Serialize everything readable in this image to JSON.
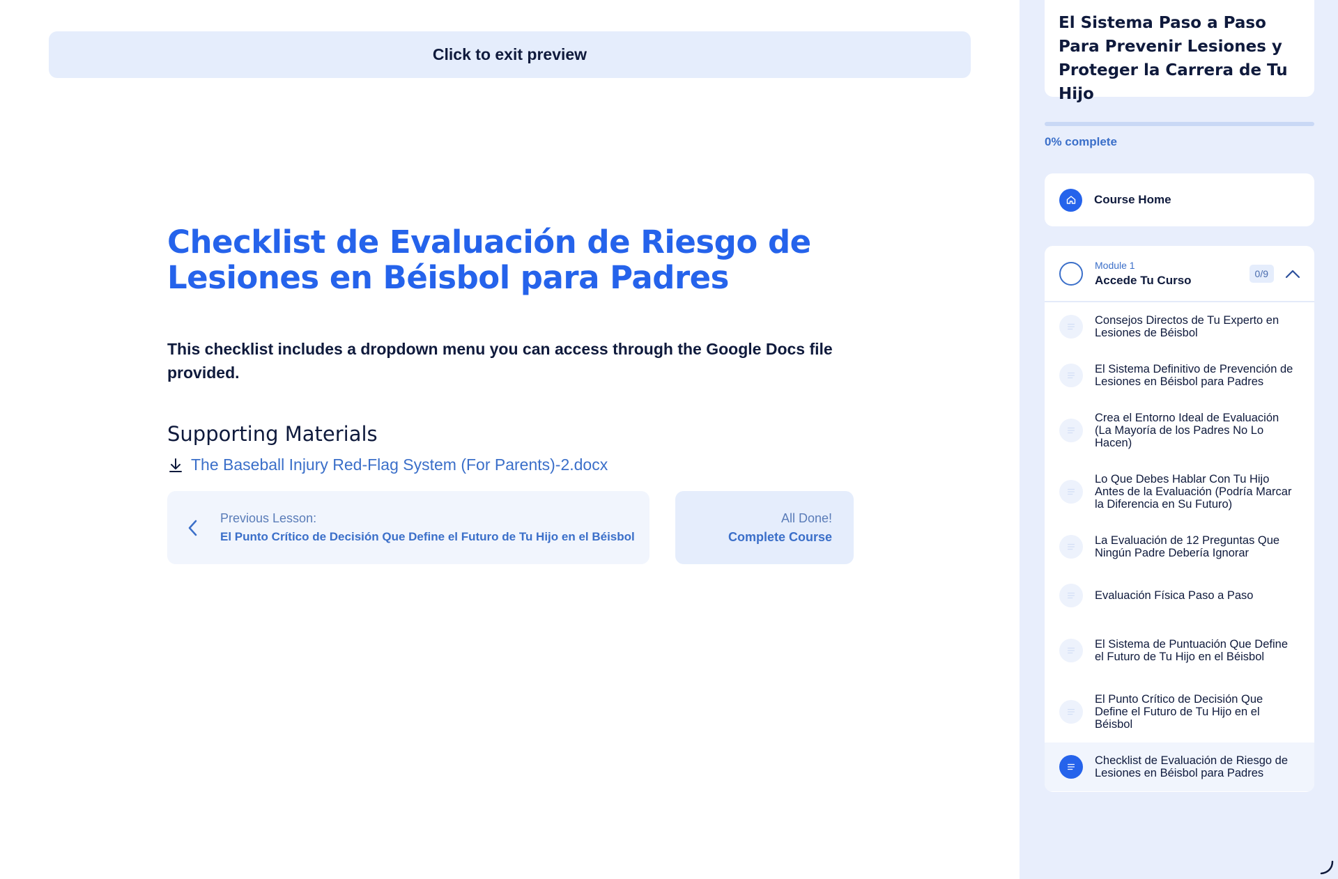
{
  "preview": {
    "exit_label": "Click to exit preview"
  },
  "lesson": {
    "title": "Checklist de Evaluación de Riesgo de Lesiones en Béisbol para Padres",
    "description": "This checklist includes a dropdown menu you can access through the Google Docs file provided.",
    "materials_heading": "Supporting Materials",
    "material_file": "The Baseball Injury Red-Flag System (For Parents)-2.docx",
    "material_icon": "download-icon"
  },
  "navigation": {
    "previous_label": "Previous Lesson:",
    "previous_name": "El Punto Crítico de Decisión Que Define el Futuro de Tu Hijo en el Béisbol",
    "done_label": "All Done!",
    "done_action": "Complete Course"
  },
  "sidebar": {
    "course_title": "El Sistema Paso a Paso Para Prevenir Lesiones y Proteger la Carrera de Tu Hijo",
    "progress_percent": 0,
    "progress_text": "0% complete",
    "home_label": "Course Home",
    "module": {
      "sub_label": "Module 1",
      "name": "Accede Tu Curso",
      "count": "0/9",
      "lessons": [
        {
          "title": "Consejos Directos de Tu Experto en Lesiones de Béisbol",
          "active": false
        },
        {
          "title": "El Sistema Definitivo de Prevención de Lesiones en Béisbol para Padres",
          "active": false
        },
        {
          "title": "Crea el Entorno Ideal de Evaluación (La Mayoría de los Padres No Lo Hacen)",
          "active": false
        },
        {
          "title": "Lo Que Debes Hablar Con Tu Hijo Antes de la Evaluación (Podría Marcar la Diferencia en Su Futuro)",
          "active": false
        },
        {
          "title": "La Evaluación de 12 Preguntas Que Ningún Padre Debería Ignorar",
          "active": false
        },
        {
          "title": "Evaluación Física Paso a Paso",
          "active": false
        },
        {
          "title": "El Sistema de Puntuación Que Define el Futuro de Tu Hijo en el Béisbol",
          "active": false
        },
        {
          "title": "El Punto Crítico de Decisión Que Define el Futuro de Tu Hijo en el Béisbol",
          "active": false
        },
        {
          "title": "Checklist de Evaluación de Riesgo de Lesiones en Béisbol para Padres",
          "active": true
        }
      ]
    }
  },
  "colors": {
    "accent": "#2563eb",
    "sidebar_bg": "#e8eefc",
    "text_dark": "#0f1a3c"
  }
}
